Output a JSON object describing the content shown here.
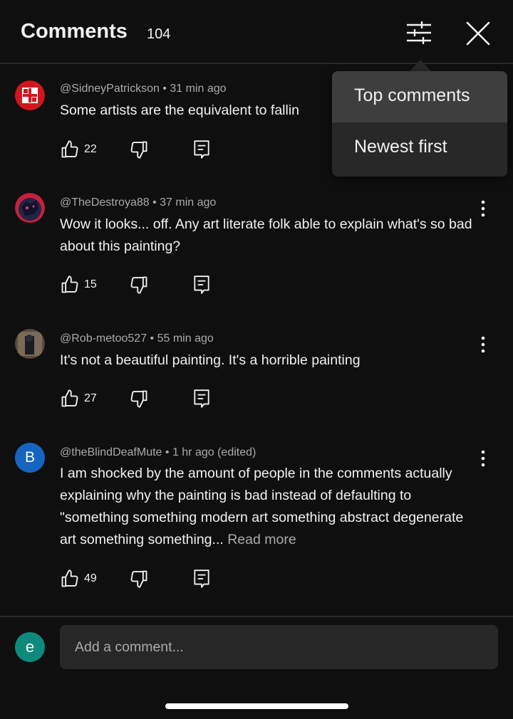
{
  "header": {
    "title": "Comments",
    "count": "104",
    "filter_icon": "sort-sliders-icon",
    "close_icon": "close-icon"
  },
  "sort_menu": {
    "items": [
      {
        "label": "Top comments",
        "selected": true
      },
      {
        "label": "Newest first",
        "selected": false
      }
    ]
  },
  "comments": [
    {
      "author": "@SidneyPatrickson",
      "time": "31 min ago",
      "text": "Some artists are the equivalent to fallin",
      "likes": "22",
      "avatar_color": "#d2161e"
    },
    {
      "author": "@TheDestroya88",
      "time": "37 min ago",
      "text": "Wow it looks... off. Any art literate folk able to explain what's so bad about this painting?",
      "likes": "15",
      "avatar_color": "#c8203a"
    },
    {
      "author": "@Rob-metoo527",
      "time": "55 min ago",
      "text": "It's not a beautiful painting. It's a horrible painting",
      "likes": "27",
      "avatar_color": "#5a4a3c"
    },
    {
      "author": "@theBlindDeafMute",
      "time": "1 hr ago (edited)",
      "text": "I am shocked by the amount of people in the comments actually explaining why the painting is bad instead of defaulting to \"something something modern art something abstract degenerate art something something...",
      "read_more": "Read more",
      "likes": "49",
      "avatar_letter": "B",
      "avatar_color": "#1565c0"
    }
  ],
  "add_comment": {
    "avatar_letter": "e",
    "avatar_color": "#0e8a7d",
    "placeholder": "Add a comment..."
  },
  "meta_separator": " • "
}
